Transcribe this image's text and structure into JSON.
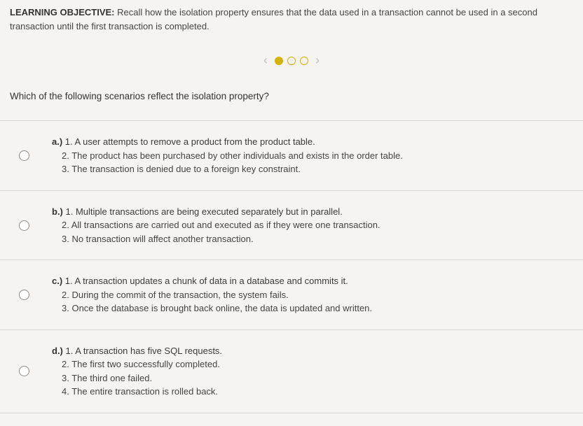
{
  "header": {
    "label": "LEARNING OBJECTIVE:",
    "text": "Recall how the isolation property ensures that the data used in a transaction cannot be used in a second transaction until the first transaction is completed."
  },
  "nav": {
    "prev": "‹",
    "next": "›",
    "total_dots": 3,
    "active_dot": 0
  },
  "question": "Which of the following scenarios reflect the isolation property?",
  "options": [
    {
      "label": "a.)",
      "lines": [
        "1. A user attempts to remove a product from the product table.",
        "2. The product has been purchased by other individuals and exists in the order table.",
        "3. The transaction is denied due to a foreign key constraint."
      ]
    },
    {
      "label": "b.)",
      "lines": [
        "1. Multiple transactions are being executed separately but in parallel.",
        "2. All transactions are carried out and executed as if they were one transaction.",
        "3. No transaction will affect another transaction."
      ]
    },
    {
      "label": "c.)",
      "lines": [
        "1. A transaction updates a chunk of data in a database and commits it.",
        "2. During the commit of the transaction, the system fails.",
        "3. Once the database is brought back online, the data is updated and written."
      ]
    },
    {
      "label": "d.)",
      "lines": [
        "1. A transaction has five SQL requests.",
        "2. The first two successfully completed.",
        "3. The third one failed.",
        "4. The entire transaction is rolled back."
      ]
    }
  ]
}
